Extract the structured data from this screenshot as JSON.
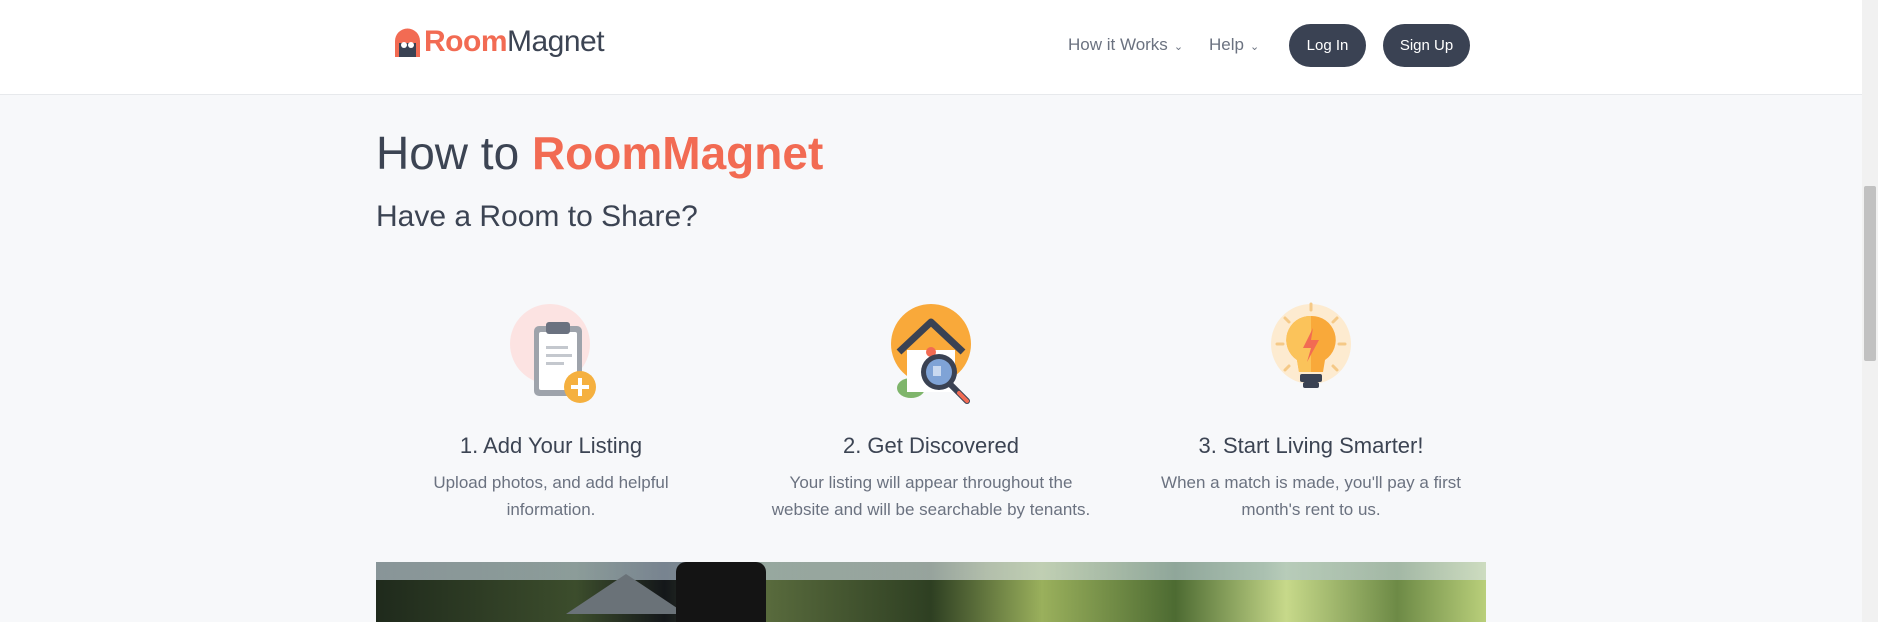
{
  "header": {
    "logo_room": "Room",
    "logo_magnet": "Magnet",
    "nav": [
      {
        "label": "How it Works"
      },
      {
        "label": "Help"
      }
    ],
    "login_label": "Log In",
    "signup_label": "Sign Up"
  },
  "main": {
    "heading_prefix": "How to ",
    "heading_brand": "RoomMagnet",
    "subheading": "Have a Room to Share?",
    "steps": [
      {
        "title": "1. Add Your Listing",
        "line1": "Upload photos, and add helpful",
        "line2": "information.",
        "icon": "clipboard-add-icon"
      },
      {
        "title": "2. Get Discovered",
        "line1": "Your listing will appear throughout the",
        "line2": "website and will be searchable by tenants.",
        "icon": "house-search-icon"
      },
      {
        "title": "3. Start Living Smarter!",
        "line1": "When a match is made, you'll pay a first",
        "line2": "month's rent to us.",
        "icon": "lightbulb-icon"
      }
    ]
  },
  "colors": {
    "brand": "#f26b53",
    "dark": "#3a4253",
    "muted": "#6b7280",
    "background": "#f7f8fa"
  }
}
